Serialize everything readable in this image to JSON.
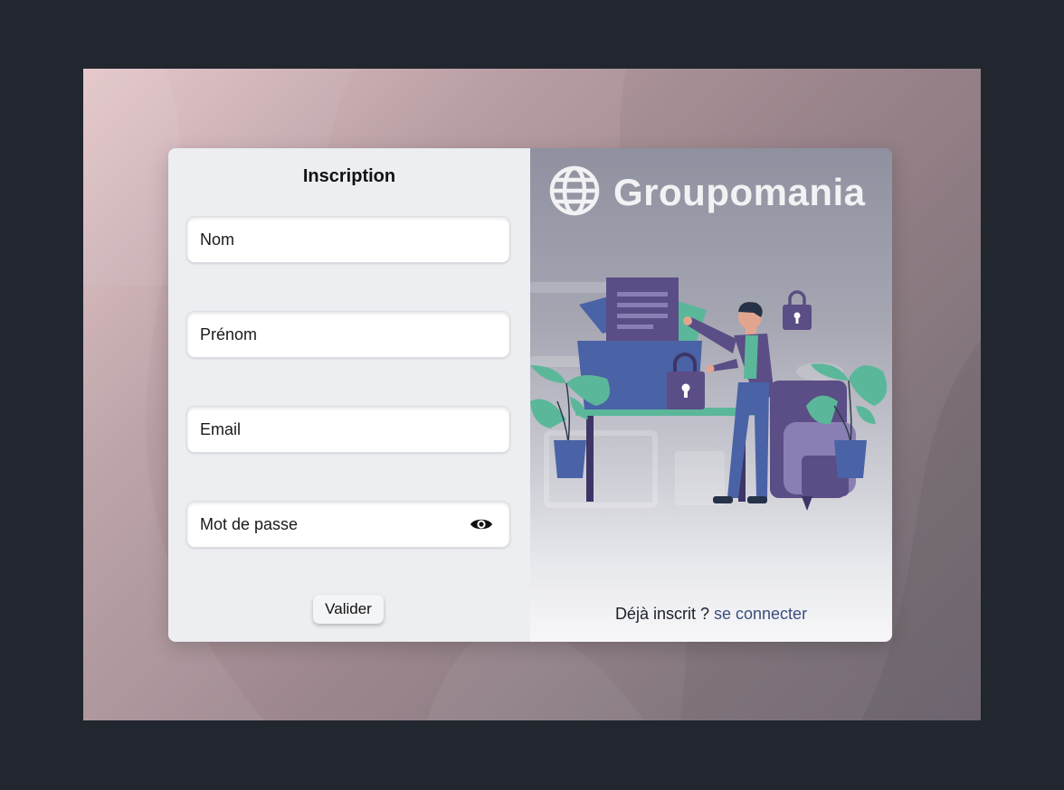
{
  "form": {
    "title": "Inscription",
    "fields": {
      "nom": {
        "placeholder": "Nom",
        "value": ""
      },
      "prenom": {
        "placeholder": "Prénom",
        "value": ""
      },
      "email": {
        "placeholder": "Email",
        "value": ""
      },
      "password": {
        "placeholder": "Mot de passe",
        "value": "",
        "toggle_icon": "eye-icon"
      }
    },
    "submit_label": "Valider"
  },
  "brand": {
    "name": "Groupomania",
    "logo_icon": "globe-icon"
  },
  "illustration": {
    "icons": [
      "lock-icon",
      "folder-icon",
      "plant-icon",
      "person-icon",
      "chair-icon"
    ]
  },
  "footer": {
    "prompt": "Déjà inscrit ?",
    "login_link": "se connecter"
  },
  "colors": {
    "page_background": "#22262f",
    "form_panel": "#eceef1",
    "link": "#3b4e7c",
    "illustration_purple": "#5b4d85",
    "illustration_blue": "#4a62a6",
    "illustration_green": "#5bb79a"
  }
}
